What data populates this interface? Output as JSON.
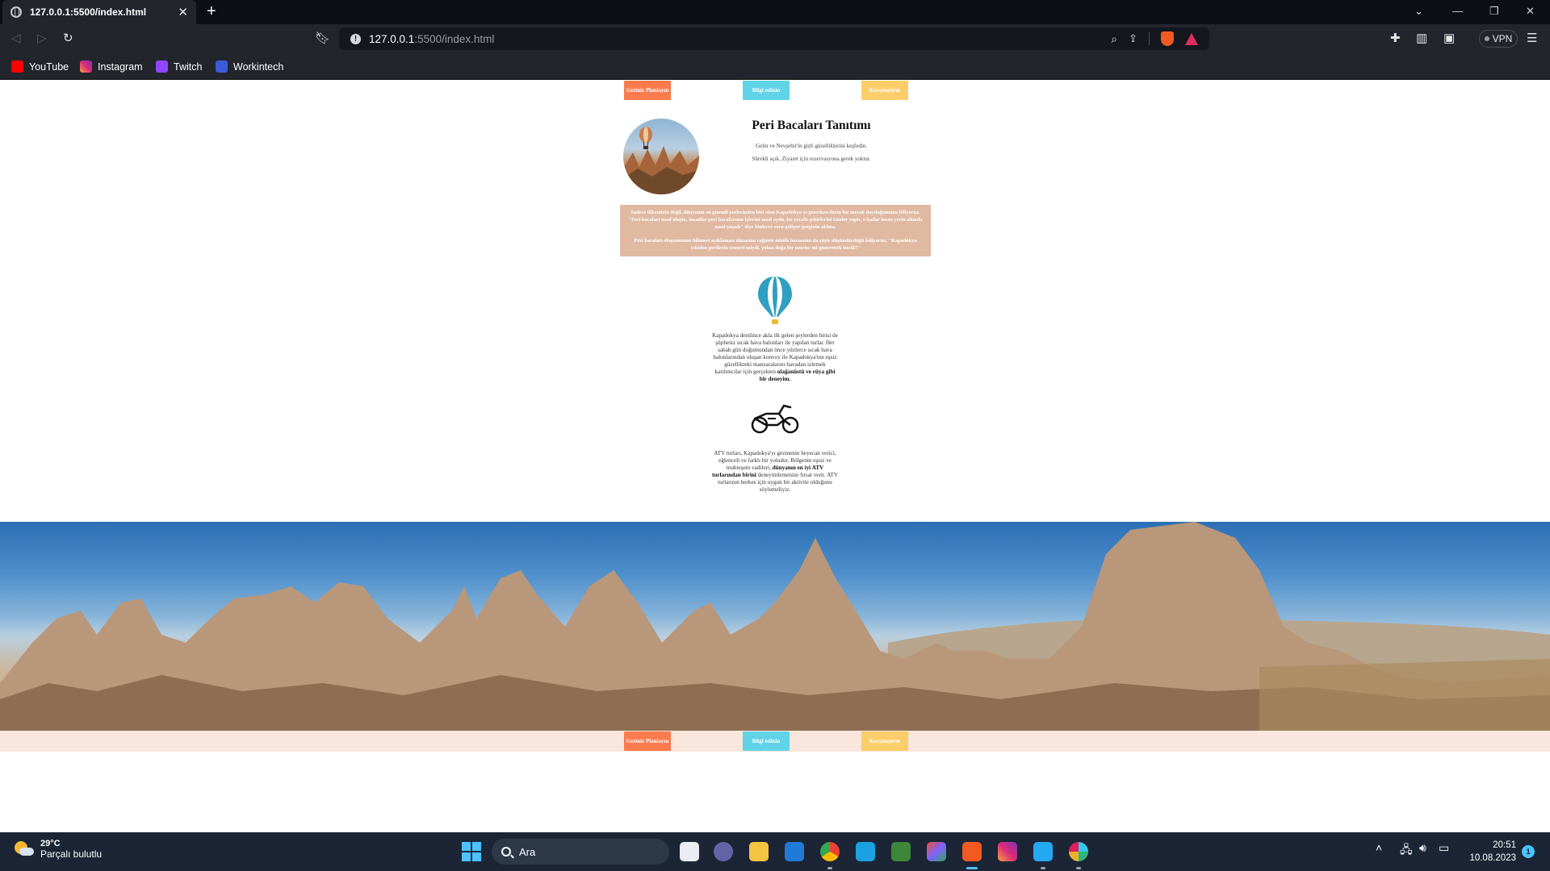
{
  "browser": {
    "tab_title": "127.0.0.1:5500/index.html",
    "url_host": "127.0.0.1",
    "url_path": ":5500/index.html",
    "vpn_label": "VPN",
    "bookmarks": [
      {
        "label": "YouTube",
        "icon": "youtube-icon",
        "color": "#ff0000"
      },
      {
        "label": "Instagram",
        "icon": "instagram-icon",
        "color": "#dd2a7b"
      },
      {
        "label": "Twitch",
        "icon": "twitch-icon",
        "color": "#9146ff"
      },
      {
        "label": "Workintech",
        "icon": "workintech-icon",
        "color": "#3b5bdb"
      }
    ]
  },
  "page": {
    "nav_buttons": [
      {
        "label": "Geziniz Planlayın",
        "color": "#fa7b4d"
      },
      {
        "label": "Bilgi edinin",
        "color": "#61d3e6"
      },
      {
        "label": "Karşılaştırın",
        "color": "#fccd69"
      }
    ],
    "intro": {
      "title": "Peri Bacaları Tanıtımı",
      "line1": "Gelin ve Nevşehir'in gizli güzelliklerini keşfedin.",
      "line2": "Sürekli açık. Ziyaret için rezervasyona gerek yoktur."
    },
    "info_box": {
      "paragraph1": "Sadece ülkemizin değil, dünyanın en gizemli yerlerinden biri olan Kapadokya'yı gezerken derin bir merak duyduğumuzu biliyoruz. \"Peri bacaları nasıl oluştu, insanlar peri bacalarının içlerini nasıl oydu, bu yeraltı şehirlerini kimler yaptı, o kadar insan yerin altında nasıl yaşadı\" diye binlerce soru geliyor gezginin aklına.",
      "paragraph2": "Peri bacaları oluşumunun bilimsel açıklaması olmasına rağmen mistik havasının da şöyle düşündürdüğü biliyoruz; \"Kapadokya eskiden perilerin cenneti miydi, yoksa doğa bir mucize mi göstermek istedi?\""
    },
    "feature_balloon": {
      "icon": "hot-air-balloon-icon",
      "text": "Kapadokya denilince akla ilk gelen şeylerden birisi de şüphesiz sıcak hava balonları ile yapılan turlar. Her sabah gün doğumundan önce yüzlerce sıcak hava balonlarından oluşan konvoy ile Kapadokya'nın eşsiz güzellikteki manzaralarını havadan izlemek katılımcılar için gerçekten",
      "bold": "olağanüstü ve rüya gibi bir deneyim."
    },
    "feature_atv": {
      "icon": "motorcycle-icon",
      "text1": "ATV turları, Kapadokya'yı gezmenin heyecan verici, eğlenceli ve farklı bir yoludur. Bölgenin eşsiz ve muhteşem vadileri,",
      "bold": "dünyanın en iyi ATV turlarından birini",
      "text2": "deneyimlemenize fırsat verir. ATV turlarının herkes için uygun bir aktivite olduğunu söylemeliyiz."
    },
    "footer_buttons": [
      {
        "label": "Geziniz Planlayın"
      },
      {
        "label": "Bilgi edinin"
      },
      {
        "label": "Karşılaştırın"
      }
    ]
  },
  "taskbar": {
    "weather_temp": "29°C",
    "weather_desc": "Parçalı bulutlu",
    "search_label": "Ara",
    "time": "20:51",
    "date": "10.08.2023",
    "notification_count": "1",
    "apps": [
      "start-icon",
      "task-view-icon",
      "teams-chat-icon",
      "file-explorer-icon",
      "mail-icon",
      "chrome-icon",
      "remote-desktop-icon",
      "node-icon",
      "git-icon",
      "brave-icon",
      "instagram-app-icon",
      "vscode-icon",
      "slack-icon"
    ]
  }
}
